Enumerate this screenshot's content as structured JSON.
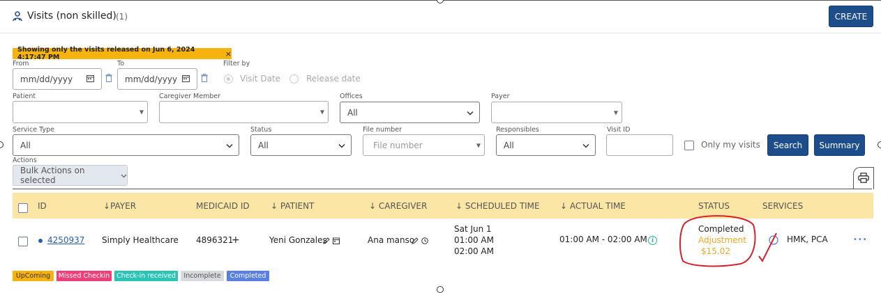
{
  "header": {
    "icon": "users-icon",
    "title": "Visits (non skilled)",
    "count": "(1)",
    "create_label": "CREATE"
  },
  "notice": {
    "text": "Showing only the visits released on Jun 6, 2024 4:17:47 PM",
    "close_glyph": "×"
  },
  "filters": {
    "from_label": "From",
    "from_placeholder": "mm/dd/yyyy",
    "to_label": "To",
    "to_placeholder": "mm/dd/yyyy",
    "filter_by_label": "Filter by",
    "filter_options": [
      "Visit Date",
      "Release date"
    ],
    "patient_label": "Patient",
    "caregiver_label": "Caregiver Member",
    "offices_label": "Offices",
    "offices_value": "All",
    "payer_label": "Payer",
    "service_type_label": "Service Type",
    "service_type_value": "All",
    "status_label": "Status",
    "status_value": "All",
    "file_number_label": "File number",
    "file_number_placeholder": "File number",
    "responsibles_label": "Responsibles",
    "responsibles_value": "All",
    "visit_id_label": "Visit ID",
    "only_my_visits_label": "Only my visits",
    "search_label": "Search",
    "summary_label": "Summary"
  },
  "actions": {
    "label": "Actions",
    "bulk_label": "Bulk Actions on selected",
    "chevron": "⌄"
  },
  "table": {
    "columns": [
      "ID",
      "↓PAYER",
      "MEDICAID ID",
      "↓ PATIENT",
      "↓ CAREGIVER",
      "↓ SCHEDULED TIME",
      "↓ ACTUAL TIME",
      "STATUS",
      "SERVICES"
    ],
    "rows": [
      {
        "id": "4250937",
        "payer": "Simply Healthcare",
        "medicaid_id": "4896321",
        "medicaid_plus": "+",
        "patient": "Yeni Gonzales",
        "caregiver": "Ana manso",
        "scheduled_day": "Sat Jun 1",
        "scheduled_start": "01:00 AM",
        "scheduled_end": "02:00 AM",
        "actual_time": "01:00 AM - 02:00 AM",
        "status": "Completed",
        "status_sub": "Adjustment",
        "status_amount": "$15.02",
        "services": "HMK, PCA",
        "more": "•••"
      }
    ]
  },
  "legend": [
    {
      "label": "UpComing",
      "color": "#f6b20f",
      "text_color": "#333"
    },
    {
      "label": "Missed Checkin",
      "color": "#ef3f79",
      "text_color": "#fff"
    },
    {
      "label": "Check-in received",
      "color": "#2cc5b5",
      "text_color": "#fff"
    },
    {
      "label": "Incomplete",
      "color": "#d6d9de",
      "text_color": "#555"
    },
    {
      "label": "Completed",
      "color": "#5a7fe0",
      "text_color": "#fff"
    }
  ],
  "colors": {
    "primary": "#1d4e8b",
    "header_row": "#fbe6a5",
    "adjustment": "#f6a623",
    "annotation": "#d8202a"
  }
}
